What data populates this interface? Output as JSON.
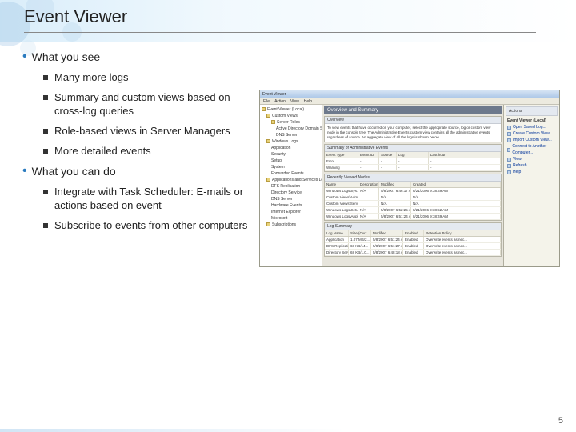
{
  "slide": {
    "title": "Event Viewer",
    "page_number": "5"
  },
  "bullets": {
    "see": {
      "heading": "What you see",
      "items": [
        "Many more logs",
        "Summary and custom views based on cross-log queries",
        "Role-based views in Server Managers",
        "More detailed events"
      ]
    },
    "do": {
      "heading": "What you can do",
      "items": [
        "Integrate with Task Scheduler: E-mails or actions based on event",
        "Subscribe to events from other computers"
      ]
    }
  },
  "app": {
    "window_title": "Event Viewer",
    "menu": {
      "file": "File",
      "action": "Action",
      "view": "View",
      "help": "Help"
    },
    "tree": [
      "Event Viewer (Local)",
      "Custom Views",
      "Server Roles",
      "Active Directory Domain Services",
      "DNS Server",
      "Windows Logs",
      "Application",
      "Security",
      "Setup",
      "System",
      "Forwarded Events",
      "Applications and Services Logs",
      "DFS Replication",
      "Directory Service",
      "DNS Server",
      "Hardware Events",
      "Internet Explorer",
      "Microsoft",
      "Subscriptions"
    ],
    "main_title": "Overview and Summary",
    "overview_head": "Overview",
    "overview_text": "To view events that have occurred on your computer, select the appropriate source, log or custom view node in the console tree. The Administrative Events custom view contains all the administrative events regardless of source. An aggregate view of all the logs is shown below.",
    "summary_head": "Summary of Administrative Events",
    "summary_cols": {
      "a": "Event Type",
      "b": "Event ID",
      "c": "Source",
      "d": "Log",
      "e": "Last hour"
    },
    "summary_rows": [
      {
        "a": "Error",
        "b": "-",
        "c": "-",
        "d": "-",
        "e": "-"
      },
      {
        "a": "Warning",
        "b": "-",
        "c": "-",
        "d": "-",
        "e": "-"
      }
    ],
    "recent_head": "Recently Viewed Nodes",
    "recent_cols": {
      "a": "Name",
      "b": "Description",
      "c": "Modified",
      "d": "Created"
    },
    "recent_rows": [
      {
        "a": "Windows Logs\\Sys...",
        "b": "N/A",
        "c": "5/8/2007 6:46:17 AM",
        "d": "8/21/2006 9:38:49 AM"
      },
      {
        "a": "Custom Views\\Admin...",
        "b": "",
        "c": "N/A",
        "d": "N/A"
      },
      {
        "a": "Custom Views\\Server Ro...",
        "b": "",
        "c": "N/A",
        "d": "N/A"
      },
      {
        "a": "Windows Logs\\Setup",
        "b": "N/A",
        "c": "5/8/2007 6:52:25 AM",
        "d": "8/21/2006 9:38:52 AM"
      },
      {
        "a": "Windows Logs\\Applic...",
        "b": "N/A",
        "c": "5/8/2007 6:51:24 AM",
        "d": "8/21/2006 9:38:49 AM"
      }
    ],
    "logsum_head": "Log Summary",
    "logsum_cols": {
      "a": "Log Name",
      "b": "Size (Curr...",
      "c": "Modified",
      "d": "Enabled",
      "e": "Retention Policy"
    },
    "logsum_rows": [
      {
        "a": "Application",
        "b": "1.07 MB/2...",
        "c": "5/8/2007 6:51:24 AM",
        "d": "Enabled",
        "e": "Overwrite events as nec..."
      },
      {
        "a": "DFS Replication",
        "b": "68 KB/14...",
        "c": "5/8/2007 6:51:27 AM",
        "d": "Enabled",
        "e": "Overwrite events as nec..."
      },
      {
        "a": "Directory Service",
        "b": "68 KB/1.0...",
        "c": "5/8/2007 6:48:18 AM",
        "d": "Enabled",
        "e": "Overwrite events as nec..."
      }
    ],
    "actions": {
      "head": "Actions",
      "subhead": "Event Viewer (Local)",
      "items": [
        "Open Saved Log...",
        "Create Custom View...",
        "Import Custom View...",
        "Connect to Another Computer...",
        "View",
        "Refresh",
        "Help"
      ]
    }
  }
}
